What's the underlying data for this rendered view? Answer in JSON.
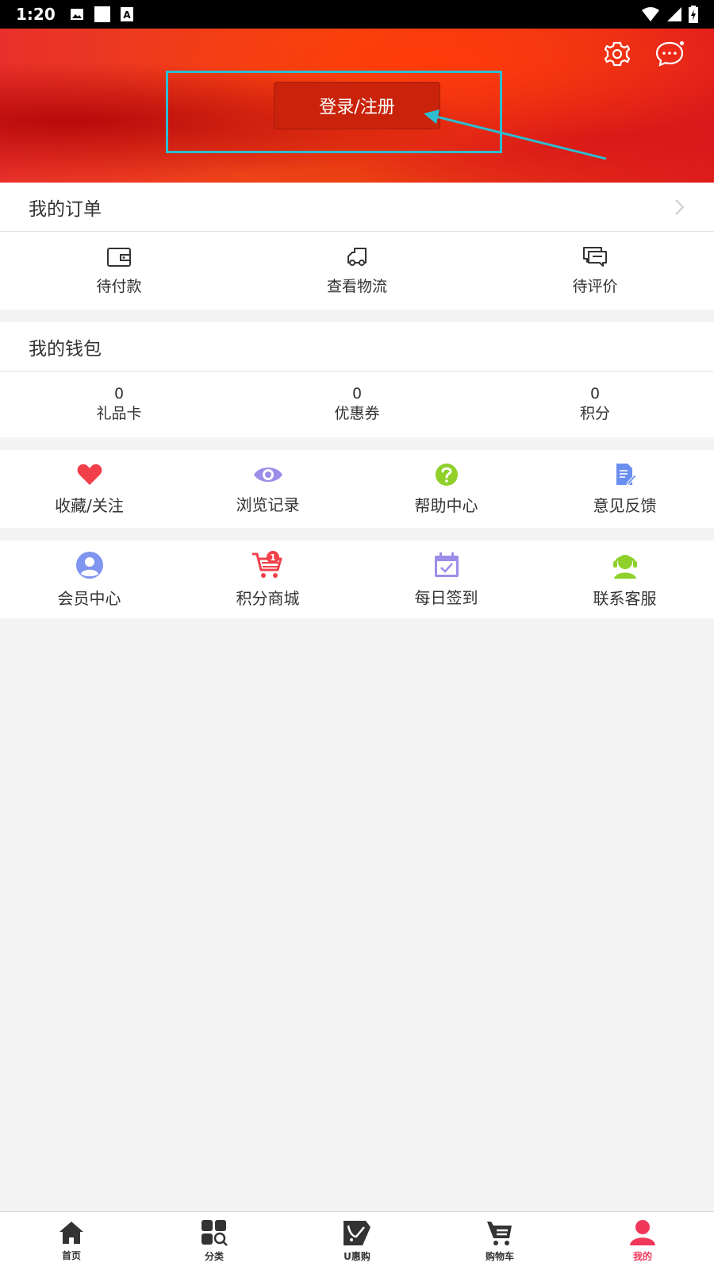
{
  "status_bar": {
    "time": "1:20"
  },
  "header": {
    "login_label": "登录/注册"
  },
  "orders": {
    "title": "我的订单",
    "items": [
      {
        "label": "待付款",
        "icon": "wallet-icon"
      },
      {
        "label": "查看物流",
        "icon": "truck-icon"
      },
      {
        "label": "待评价",
        "icon": "comment-icon"
      }
    ]
  },
  "wallet": {
    "title": "我的钱包",
    "items": [
      {
        "value": "0",
        "label": "礼品卡"
      },
      {
        "value": "0",
        "label": "优惠券"
      },
      {
        "value": "0",
        "label": "积分"
      }
    ]
  },
  "tools_row1": [
    {
      "label": "收藏/关注",
      "icon": "heart-icon",
      "color": "#f2404b"
    },
    {
      "label": "浏览记录",
      "icon": "eye-icon",
      "color": "#9d8ce8"
    },
    {
      "label": "帮助中心",
      "icon": "question-icon",
      "color": "#8fd12a"
    },
    {
      "label": "意见反馈",
      "icon": "feedback-icon",
      "color": "#6b8ff0"
    }
  ],
  "tools_row2": [
    {
      "label": "会员中心",
      "icon": "member-icon",
      "color": "#7f95f0"
    },
    {
      "label": "积分商城",
      "icon": "cart-icon",
      "color": "#f2404b",
      "badge": "1"
    },
    {
      "label": "每日签到",
      "icon": "calendar-icon",
      "color": "#9d8ce8"
    },
    {
      "label": "联系客服",
      "icon": "support-icon",
      "color": "#8fd12a"
    }
  ],
  "bottom_nav": [
    {
      "label": "首页",
      "icon": "home-icon"
    },
    {
      "label": "分类",
      "icon": "category-icon"
    },
    {
      "label": "U惠购",
      "icon": "tag-icon"
    },
    {
      "label": "购物车",
      "icon": "cart-nav-icon"
    },
    {
      "label": "我的",
      "icon": "person-icon",
      "active": true
    }
  ],
  "colors": {
    "accent": "#f0375a",
    "header_red": "#e8302a",
    "highlight": "#2dbdd1"
  }
}
